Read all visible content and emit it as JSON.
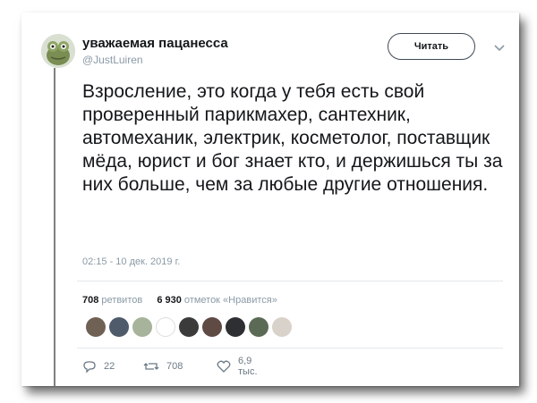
{
  "tweet": {
    "display_name": "уважаемая пацанесса",
    "handle": "@JustLuiren",
    "follow_label": "Читать",
    "text": "Взросление, это когда у тебя есть свой проверенный парикмахер, сантехник, автомеханик, электрик, косметолог, поставщик мёда, юрист и бог знает кто, и держишься ты за них больше, чем за любые другие отношения.",
    "timestamp": "02:15 - 10 дек. 2019 г."
  },
  "stats": {
    "retweets_count": "708",
    "retweets_label": "ретвитов",
    "likes_count": "6 930",
    "likes_label": "отметок «Нравится»"
  },
  "actions": {
    "replies": "22",
    "retweets": "708",
    "likes": "6,9 тыс."
  },
  "colors": {
    "text": "#14171a",
    "muted": "#8a9aa6",
    "border": "#e3e8ec"
  },
  "icons": [
    "chevron-down-icon",
    "reply-icon",
    "retweet-icon",
    "like-icon"
  ]
}
